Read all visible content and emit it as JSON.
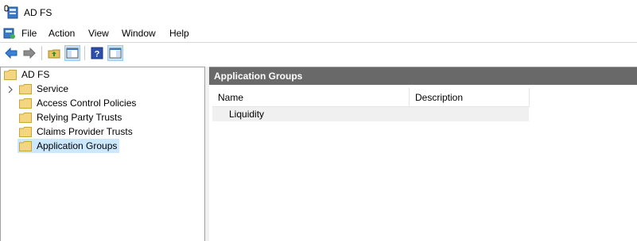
{
  "window": {
    "title": "AD FS"
  },
  "menu": {
    "items": [
      "File",
      "Action",
      "View",
      "Window",
      "Help"
    ]
  },
  "toolbar": {
    "buttons": [
      "back-icon",
      "forward-icon",
      "up-folder-icon",
      "show-hide-console-tree-icon",
      "help-icon",
      "show-hide-action-pane-icon"
    ]
  },
  "tree": {
    "root": "AD FS",
    "items": [
      "Service",
      "Access Control Policies",
      "Relying Party Trusts",
      "Claims Provider Trusts",
      "Application Groups"
    ],
    "selected": "Application Groups"
  },
  "content": {
    "header": "Application Groups",
    "columns": [
      "Name",
      "Description"
    ],
    "rows": [
      {
        "name": "Liquidity",
        "description": ""
      }
    ]
  },
  "colors": {
    "header_bg": "#696969",
    "selection_bg": "#cce8ff",
    "folder": "#f5d680"
  }
}
